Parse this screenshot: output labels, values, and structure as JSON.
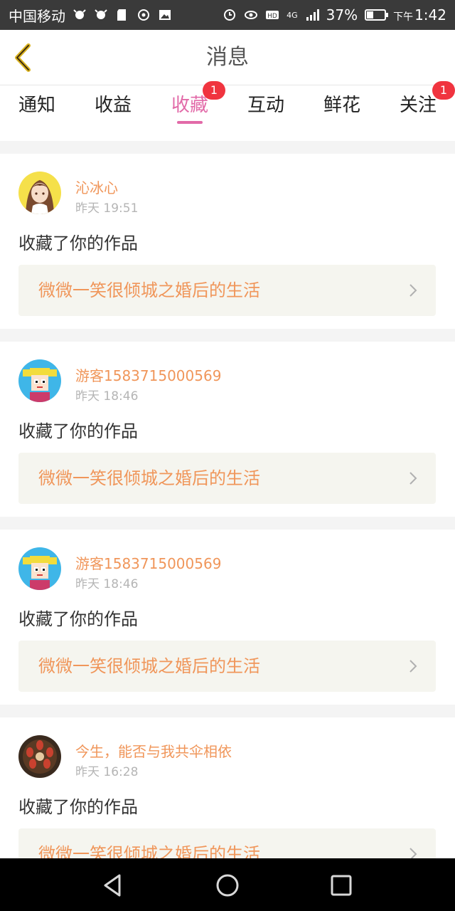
{
  "status_bar": {
    "carrier": "中国移动",
    "network": "4G",
    "battery": "37%",
    "battery_level": 0.37,
    "time_prefix": "下午",
    "time": "1:42",
    "icons": [
      "signal-icon",
      "notification-icon",
      "sd-card-icon",
      "sync-icon",
      "image-icon",
      "alarm-icon",
      "eye-icon",
      "hd-icon",
      "battery-icon"
    ]
  },
  "header": {
    "back_icon": "chevron-left-icon",
    "title": "消息"
  },
  "tabs": [
    {
      "label": "通知",
      "badge": null,
      "active": false
    },
    {
      "label": "收益",
      "badge": null,
      "active": false
    },
    {
      "label": "收藏",
      "badge": "1",
      "active": true
    },
    {
      "label": "互动",
      "badge": null,
      "active": false
    },
    {
      "label": "鲜花",
      "badge": null,
      "active": false
    },
    {
      "label": "关注",
      "badge": "1",
      "active": false
    }
  ],
  "feed": [
    {
      "user": "沁冰心",
      "time": "昨天 19:51",
      "action": "收藏了你的作品",
      "work": "微微一笑很倾城之婚后的生活",
      "avatar": "anime-girl-avatar"
    },
    {
      "user": "游客1583715000569",
      "time": "昨天 18:46",
      "action": "收藏了你的作品",
      "work": "微微一笑很倾城之婚后的生活",
      "avatar": "pixel-guest-avatar"
    },
    {
      "user": "游客1583715000569",
      "time": "昨天 18:46",
      "action": "收藏了你的作品",
      "work": "微微一笑很倾城之婚后的生活",
      "avatar": "pixel-guest-avatar"
    },
    {
      "user": "今生，能否与我共伞相依",
      "time": "昨天 16:28",
      "action": "收藏了你的作品",
      "work": "微微一笑很倾城之婚后的生活",
      "avatar": "food-avatar"
    }
  ],
  "colors": {
    "accent": "#e26aa8",
    "username": "#f0965a",
    "badge": "#f0343f",
    "statusbar": "#3a3a3a"
  },
  "nav": [
    "back-icon",
    "home-icon",
    "recents-icon"
  ]
}
